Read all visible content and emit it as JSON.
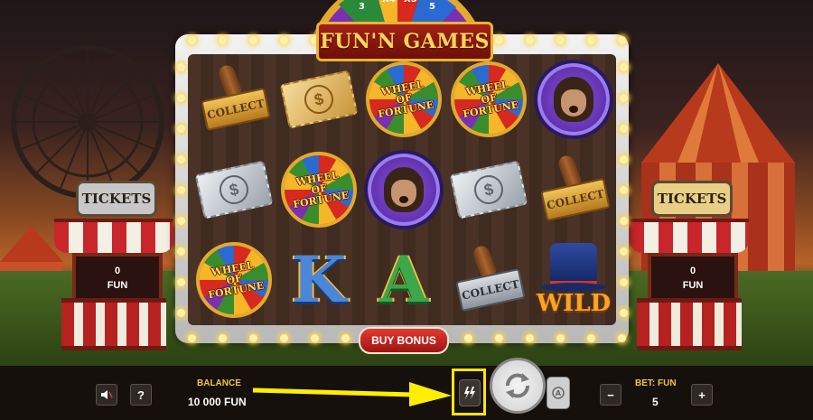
{
  "game": {
    "logo": "FUN'N GAMES",
    "top_wheel_labels": [
      "3",
      "X4",
      "X5",
      "5"
    ],
    "buy_bonus_label": "BUY BONUS"
  },
  "booths": {
    "left": {
      "sign": "TICKETS",
      "count": "0",
      "unit": "FUN"
    },
    "right": {
      "sign": "TICKETS",
      "count": "0",
      "unit": "FUN"
    }
  },
  "reels": {
    "rows": [
      [
        "collect-stamp-gold",
        "ticket-gold",
        "wheel-of-fortune",
        "wheel-of-fortune",
        "chimp-chip"
      ],
      [
        "ticket-silver",
        "wheel-of-fortune",
        "chimp-chip",
        "ticket-silver",
        "collect-stamp-gold"
      ],
      [
        "wheel-of-fortune",
        "letter-k",
        "letter-a",
        "collect-stamp-silver",
        "wild-hat"
      ]
    ],
    "labels": {
      "collect": "COLLECT",
      "ticket": "$",
      "wheel": "WHEEL\nOF\nFORTUNE",
      "k": "K",
      "a": "A",
      "wild": "WILD"
    }
  },
  "bottom_bar": {
    "balance_label": "BALANCE",
    "balance_value": "10 000 FUN",
    "bet_label": "BET: FUN",
    "bet_value": "5",
    "help_label": "?",
    "minus_label": "−",
    "plus_label": "+",
    "sound_icon": "speaker-muted-icon",
    "turbo_icon": "lightning-icon",
    "spin_icon": "refresh-arrows-icon",
    "autoplay_icon": "autoplay-icon"
  },
  "annotation": {
    "color": "#ffee00",
    "arrow_target": "turbo-button"
  }
}
